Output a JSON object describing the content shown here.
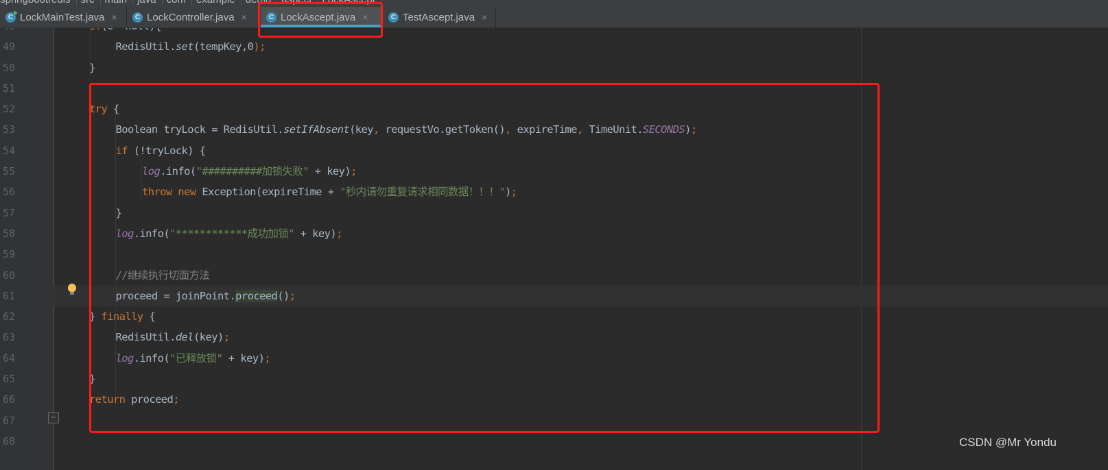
{
  "breadcrumb": [
    "springbootredis",
    "src",
    "main",
    "java",
    "com",
    "example",
    "demo",
    "aspect",
    "LockAscept"
  ],
  "tabs": [
    {
      "label": "LockMainTest.java",
      "icon": "java-class-runnable-icon",
      "active": false
    },
    {
      "label": "LockController.java",
      "icon": "java-class-icon",
      "active": false
    },
    {
      "label": "LockAscept.java",
      "icon": "java-class-icon",
      "active": true
    },
    {
      "label": "TestAscept.java",
      "icon": "java-class-icon",
      "active": false
    }
  ],
  "tab_close_glyph": "×",
  "tab_icon_letter": "C",
  "editor": {
    "current_line": 61,
    "lines": [
      {
        "n": "48",
        "indent": 1,
        "tokens": [
          [
            "k",
            "if"
          ],
          [
            "",
            "(o==null){"
          ]
        ]
      },
      {
        "n": "49",
        "indent": 2,
        "tokens": [
          [
            "",
            "RedisUtil."
          ],
          [
            "i",
            "set"
          ],
          [
            "",
            "(tempKey,"
          ],
          [
            "",
            "0"
          ],
          [
            "k",
            ");"
          ]
        ]
      },
      {
        "n": "50",
        "indent": 1,
        "tokens": [
          [
            "",
            "}"
          ]
        ]
      },
      {
        "n": "51",
        "indent": 0,
        "tokens": []
      },
      {
        "n": "52",
        "indent": 1,
        "tokens": [
          [
            "k",
            "try"
          ],
          [
            "",
            " {"
          ]
        ]
      },
      {
        "n": "53",
        "indent": 2,
        "tokens": [
          [
            "",
            "Boolean tryLock = RedisUtil."
          ],
          [
            "i",
            "setIfAbsent"
          ],
          [
            "",
            "(key"
          ],
          [
            "k",
            ","
          ],
          [
            "",
            " requestVo.getToken()"
          ],
          [
            "k",
            ","
          ],
          [
            "",
            " expireTime"
          ],
          [
            "k",
            ","
          ],
          [
            "",
            " TimeUnit."
          ],
          [
            "st",
            "SECONDS"
          ],
          [
            "",
            ")"
          ],
          [
            "k",
            ";"
          ]
        ]
      },
      {
        "n": "54",
        "indent": 2,
        "tokens": [
          [
            "k",
            "if"
          ],
          [
            "",
            " (!tryLock) {"
          ]
        ]
      },
      {
        "n": "55",
        "indent": 3,
        "tokens": [
          [
            "st",
            "log"
          ],
          [
            "",
            ".info("
          ],
          [
            "s",
            "\"##########加锁失败\""
          ],
          [
            "",
            " + key)"
          ],
          [
            "k",
            ";"
          ]
        ]
      },
      {
        "n": "56",
        "indent": 3,
        "tokens": [
          [
            "k",
            "throw new "
          ],
          [
            "",
            "Exception(expireTime + "
          ],
          [
            "s",
            "\"秒内请勿重复请求相同数据！！！\""
          ],
          [
            "",
            ")"
          ],
          [
            "k",
            ";"
          ]
        ]
      },
      {
        "n": "57",
        "indent": 2,
        "tokens": [
          [
            "",
            "}"
          ]
        ]
      },
      {
        "n": "58",
        "indent": 2,
        "tokens": [
          [
            "st",
            "log"
          ],
          [
            "",
            ".info("
          ],
          [
            "s",
            "\"************成功加锁\""
          ],
          [
            "",
            " + key)"
          ],
          [
            "k",
            ";"
          ]
        ]
      },
      {
        "n": "59",
        "indent": 0,
        "tokens": []
      },
      {
        "n": "60",
        "indent": 2,
        "tokens": [
          [
            "cm",
            "//继续执行切面方法"
          ]
        ]
      },
      {
        "n": "61",
        "indent": 2,
        "tokens": [
          [
            "",
            "proceed = joinPoint."
          ],
          [
            "hl",
            "proceed"
          ],
          [
            "",
            "()"
          ],
          [
            "k",
            ";"
          ]
        ]
      },
      {
        "n": "62",
        "indent": 1,
        "tokens": [
          [
            "",
            "} "
          ],
          [
            "k",
            "finally"
          ],
          [
            "",
            " {"
          ]
        ]
      },
      {
        "n": "63",
        "indent": 2,
        "tokens": [
          [
            "",
            "RedisUtil."
          ],
          [
            "i",
            "del"
          ],
          [
            "",
            "(key)"
          ],
          [
            "k",
            ";"
          ]
        ]
      },
      {
        "n": "64",
        "indent": 2,
        "tokens": [
          [
            "st",
            "log"
          ],
          [
            "",
            ".info("
          ],
          [
            "s",
            "\"已释放锁\""
          ],
          [
            "",
            " + key)"
          ],
          [
            "k",
            ";"
          ]
        ]
      },
      {
        "n": "65",
        "indent": 1,
        "tokens": [
          [
            "",
            "}"
          ]
        ]
      },
      {
        "n": "66",
        "indent": 1,
        "tokens": [
          [
            "k",
            "return"
          ],
          [
            "",
            " proceed"
          ],
          [
            "k",
            ";"
          ]
        ]
      },
      {
        "n": "67",
        "indent": 0,
        "tokens": []
      },
      {
        "n": "68",
        "indent": 0,
        "tokens": []
      }
    ]
  },
  "colors": {
    "highlight_box": "#ff1a1a",
    "keyword": "#cc7832",
    "string": "#6a8759",
    "static_field": "#9876aa",
    "comment": "#808080",
    "text": "#a9b7c6",
    "tab_underline": "#4a9fc4"
  },
  "watermark": "CSDN @Mr Yondu"
}
